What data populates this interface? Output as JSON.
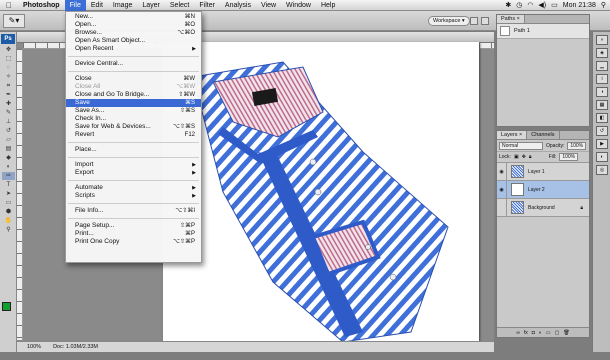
{
  "menubar": {
    "apple": "",
    "items": [
      "Photoshop",
      "File",
      "Edit",
      "Image",
      "Layer",
      "Select",
      "Filter",
      "Analysis",
      "View",
      "Window",
      "Help"
    ],
    "active": "File",
    "clock": "Mon 21:38"
  },
  "options": {
    "workspace_label": "Workspace ▾"
  },
  "tools": {
    "logo": "Ps"
  },
  "file_menu": {
    "items": [
      {
        "label": "New...",
        "shortcut": "⌘N"
      },
      {
        "label": "Open...",
        "shortcut": "⌘O"
      },
      {
        "label": "Browse...",
        "shortcut": "⌥⌘O"
      },
      {
        "label": "Open As Smart Object...",
        "shortcut": ""
      },
      {
        "label": "Open Recent",
        "shortcut": ""
      },
      {
        "label": "Device Central...",
        "shortcut": ""
      },
      {
        "label": "Close",
        "shortcut": "⌘W"
      },
      {
        "label": "Close All",
        "shortcut": "⌥⌘W"
      },
      {
        "label": "Close and Go To Bridge...",
        "shortcut": "⇧⌘W"
      },
      {
        "label": "Save",
        "shortcut": "⌘S"
      },
      {
        "label": "Save As...",
        "shortcut": "⇧⌘S"
      },
      {
        "label": "Check In...",
        "shortcut": ""
      },
      {
        "label": "Save for Web & Devices...",
        "shortcut": "⌥⇧⌘S"
      },
      {
        "label": "Revert",
        "shortcut": "F12"
      },
      {
        "label": "Place...",
        "shortcut": ""
      },
      {
        "label": "Import",
        "shortcut": ""
      },
      {
        "label": "Export",
        "shortcut": ""
      },
      {
        "label": "Automate",
        "shortcut": ""
      },
      {
        "label": "Scripts",
        "shortcut": ""
      },
      {
        "label": "File Info...",
        "shortcut": "⌥⇧⌘I"
      },
      {
        "label": "Page Setup...",
        "shortcut": "⇧⌘P"
      },
      {
        "label": "Print...",
        "shortcut": "⌘P"
      },
      {
        "label": "Print One Copy",
        "shortcut": "⌥⇧⌘P"
      }
    ],
    "highlighted": "Save",
    "disabled": [
      "Close All"
    ]
  },
  "document": {
    "zoom": "100%",
    "doc_size": "Doc: 1.03M/2.33M"
  },
  "paths_panel": {
    "tab": "Paths ×",
    "path_name": "Path 1"
  },
  "layers_panel": {
    "tabs": [
      "Layers ×",
      "Channels"
    ],
    "blend_mode": "Normal",
    "opacity_label": "Opacity:",
    "opacity": "100%",
    "lock_label": "Lock:",
    "fill_label": "Fill:",
    "fill": "100%",
    "layers": [
      "Layer 1",
      "Layer 2",
      "Background"
    ],
    "selected": "Layer 2"
  },
  "colors": {
    "highlight": "#3a69d4",
    "foreground": "#11a02f",
    "shirt_stripe": "#3f6fd9"
  }
}
